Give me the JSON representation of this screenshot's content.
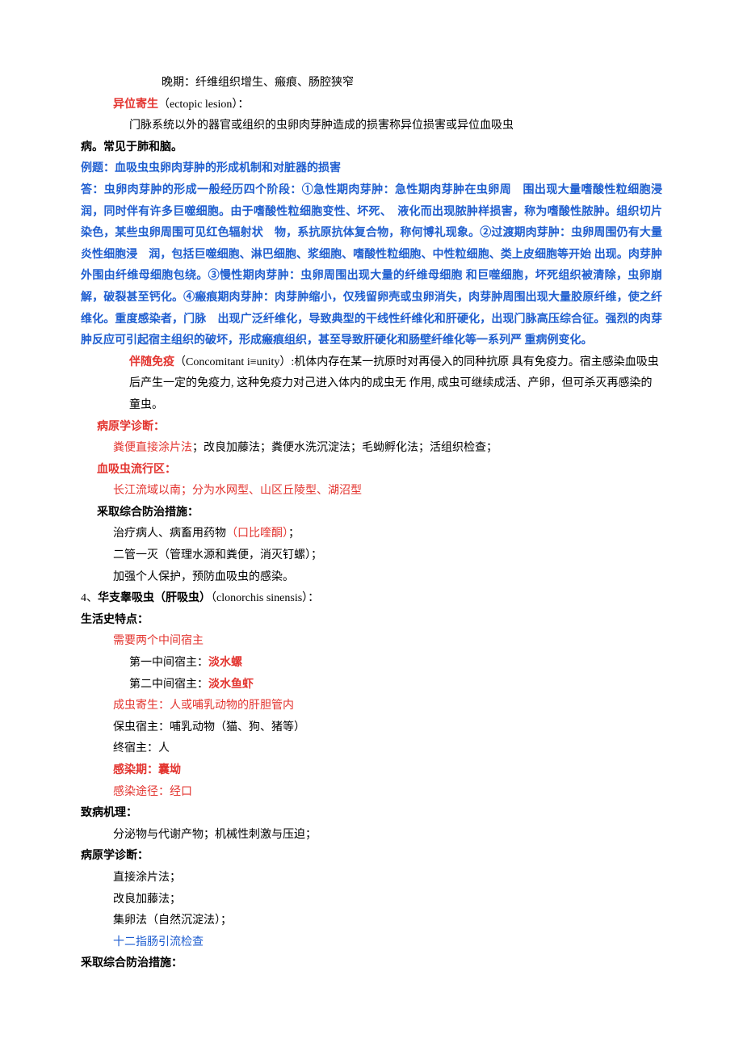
{
  "lines": {
    "l1": "晚期：纤维组织增生、瘢痕、肠腔狭窄",
    "l2a": "异位寄生",
    "l2b": "（ectopic lesion）：",
    "l3": "门脉系统以外的器官或组织的虫卵肉芽肿造成的损害称异位损害或异位血吸虫",
    "l4": "病。常见于肺和脑。",
    "l5": "例题：血吸虫虫卵肉芽肿的形成机制和对脏器的损害",
    "l6": "答：虫卵肉芽肿的形成一般经历四个阶段：①急性期肉芽肿：急性期肉芽肿在虫卵周　围出现大量嗜酸性粒细胞浸润，同时伴有许多巨噬细胞。由于嗜酸性粒细胞变性、坏死、　液化而出现脓肿样损害，称为嗜酸性脓肿。组织切片染色，某些虫卵周围可见红色辐射状　物，系抗原抗体复合物，称何博礼现象。②过渡期肉芽肿：虫卵周围仍有大量炎性细胞浸　润，包括巨噬细胞、淋巴细胞、浆细胞、嗜酸性粒细胞、中性粒细胞、类上皮细胞等开始 出现。肉芽肿外围由纤维母细胞包绕。③慢性期肉芽肿：虫卵周围出现大量的纤维母细胞 和巨噬细胞，坏死组织被清除，虫卵崩解，破裂甚至钙化。④瘢痕期肉芽肿：肉芽肿缩小，仅残留卵壳或虫卵消失，肉芽肿周围出现大量胶原纤维，使之纤维化。重度感染者，门脉　出现广泛纤维化，导致典型的干线性纤维化和肝硬化，出现门脉高压综合征。强烈的肉芽　肿反应可引起宿主组织的破坏，形成瘢痕组织，甚至导致肝硬化和肠壁纤维化等一系列严 重病例变化。",
    "l7a": "伴随免疫",
    "l7b": "（Concomitant i≡unity）:机体内存在某一抗原时对再侵入的同种抗原 具有免疫力。宿主感染血吸虫后产生一定的免疫力, 这种免疫力对己进入体内的成虫无 作用, 成虫可继续成活、产卵，但可杀灭再感染的童虫。",
    "l8": "病原学诊断：",
    "l9a": "粪便直接涂片法",
    "l9b": "；改良加藤法；粪便水洗沉淀法；毛蚴孵化法；活组织检查；",
    "l10": "血吸虫流行区：",
    "l11": "长江流域以南；分为水网型、山区丘陵型、湖沼型",
    "l12": "釆取综合防治措施：",
    "l13a": "治疗病人、病畜用药物",
    "l13b": "（口比喹酮）",
    "l13c": "；",
    "l14": "二管一灭（管理水源和粪便，消灭钉螺）；",
    "l15": "加强个人保护，预防血吸虫的感染。",
    "l16a": "4、",
    "l16b": "华支睾吸虫（肝吸虫）",
    "l16c": "（clonorchis sinensis）：",
    "l17": "生活史特点：",
    "l18": "需要两个中间宿主",
    "l19a": "第一中间宿主：",
    "l19b": "淡水螺",
    "l20a": "第二中间宿主：",
    "l20b": "淡水鱼虾",
    "l21": "成虫寄生：人或哺乳动物的肝胆管内",
    "l22": "保虫宿主：哺乳动物（猫、狗、猪等）",
    "l23": "终宿主：人",
    "l24": "感染期：囊坳",
    "l25": "感染途径：经口",
    "l26": "致病机理：",
    "l27": "分泌物与代谢产物；机械性刺激与压迫；",
    "l28": "病原学诊断：",
    "l29": "直接涂片法；",
    "l30": "改良加藤法；",
    "l31": "集卵法（自然沉淀法）；",
    "l32": "十二指肠引流检查",
    "l33": "釆取综合防治措施："
  }
}
